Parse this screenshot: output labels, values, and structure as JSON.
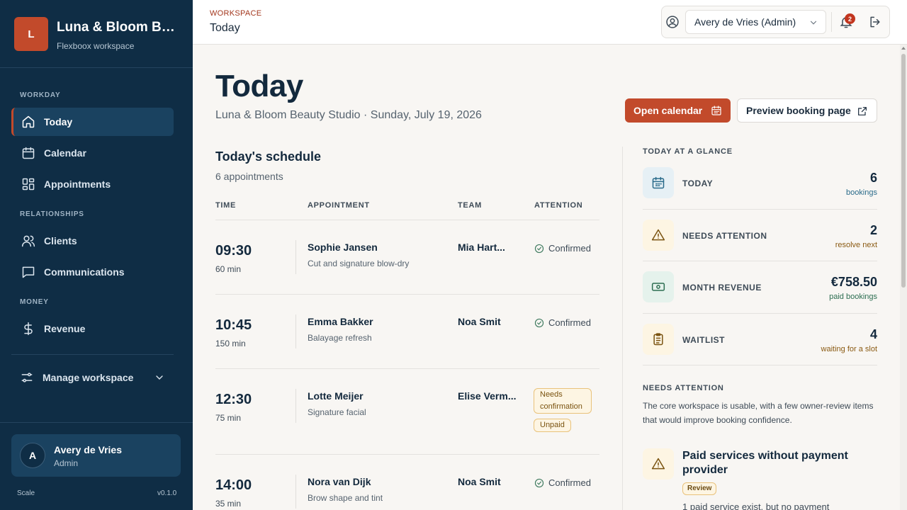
{
  "brand": {
    "logo_letter": "L",
    "name": "Luna & Bloom Beauty Studio",
    "subtitle": "Flexboox workspace"
  },
  "sidebar": {
    "sections": [
      "WORKDAY",
      "RELATIONSHIPS",
      "MONEY"
    ],
    "items": [
      {
        "label": "Today",
        "icon": "home-icon",
        "active": true
      },
      {
        "label": "Calendar",
        "icon": "calendar-icon"
      },
      {
        "label": "Appointments",
        "icon": "grid-icon"
      },
      {
        "label": "Clients",
        "icon": "users-icon"
      },
      {
        "label": "Communications",
        "icon": "message-icon"
      },
      {
        "label": "Revenue",
        "icon": "dollar-icon"
      }
    ],
    "manage_label": "Manage workspace",
    "user": {
      "initial": "A",
      "name": "Avery de Vries",
      "role": "Admin"
    },
    "footer_left": "Scale",
    "footer_right": "v0.1.0"
  },
  "topbar": {
    "eyebrow": "WORKSPACE",
    "title": "Today",
    "user_select": "Avery de Vries (Admin)",
    "notification_count": "2"
  },
  "page": {
    "title": "Today",
    "subtitle": "Luna & Bloom Beauty Studio · Sunday, July 19, 2026",
    "primary_button": "Open calendar",
    "secondary_button": "Preview booking page"
  },
  "schedule": {
    "title": "Today's schedule",
    "count": "6 appointments",
    "headers": [
      "TIME",
      "APPOINTMENT",
      "TEAM",
      "ATTENTION"
    ],
    "rows": [
      {
        "time": "09:30",
        "duration": "60 min",
        "client": "Sophie Jansen",
        "service": "Cut and signature blow-dry",
        "team": "Mia Hart...",
        "status": "Confirmed"
      },
      {
        "time": "10:45",
        "duration": "150 min",
        "client": "Emma Bakker",
        "service": "Balayage refresh",
        "team": "Noa Smit",
        "status": "Confirmed"
      },
      {
        "time": "12:30",
        "duration": "75 min",
        "client": "Lotte Meijer",
        "service": "Signature facial",
        "team": "Elise Verm...",
        "badges": [
          "Needs confirmation",
          "Unpaid"
        ]
      },
      {
        "time": "14:00",
        "duration": "35 min",
        "client": "Nora van Dijk",
        "service": "Brow shape and tint",
        "team": "Noa Smit",
        "status": "Confirmed"
      }
    ]
  },
  "glance": {
    "title": "TODAY AT A GLANCE",
    "items": [
      {
        "label": "TODAY",
        "value": "6",
        "caption": "bookings",
        "icon": "calendar-icon",
        "bg": "#e6f0f5",
        "stroke": "#2a6b8a",
        "cap_color": "#2a6b8a"
      },
      {
        "label": "NEEDS ATTENTION",
        "value": "2",
        "caption": "resolve next",
        "icon": "warning-icon",
        "bg": "#fdf5e3",
        "stroke": "#7a5310",
        "cap_color": "#8a5a12"
      },
      {
        "label": "MONTH REVENUE",
        "value": "€758.50",
        "caption": "paid bookings",
        "icon": "cash-icon",
        "bg": "#e5f2ec",
        "stroke": "#2c6e51",
        "cap_color": "#2c6e51"
      },
      {
        "label": "WAITLIST",
        "value": "4",
        "caption": "waiting for a slot",
        "icon": "clipboard-icon",
        "bg": "#fdf5e3",
        "stroke": "#7a5310",
        "cap_color": "#8a5a12"
      }
    ]
  },
  "attention": {
    "title": "NEEDS ATTENTION",
    "description": "The core workspace is usable, with a few owner-review items that would improve booking confidence.",
    "item": {
      "title": "Paid services without payment provider",
      "badge": "Review",
      "body": "1 paid service exist, but no payment"
    }
  },
  "colors": {
    "sidebar": "#0f2d45",
    "accent": "#c24a2b",
    "background": "#f8f6f3"
  }
}
